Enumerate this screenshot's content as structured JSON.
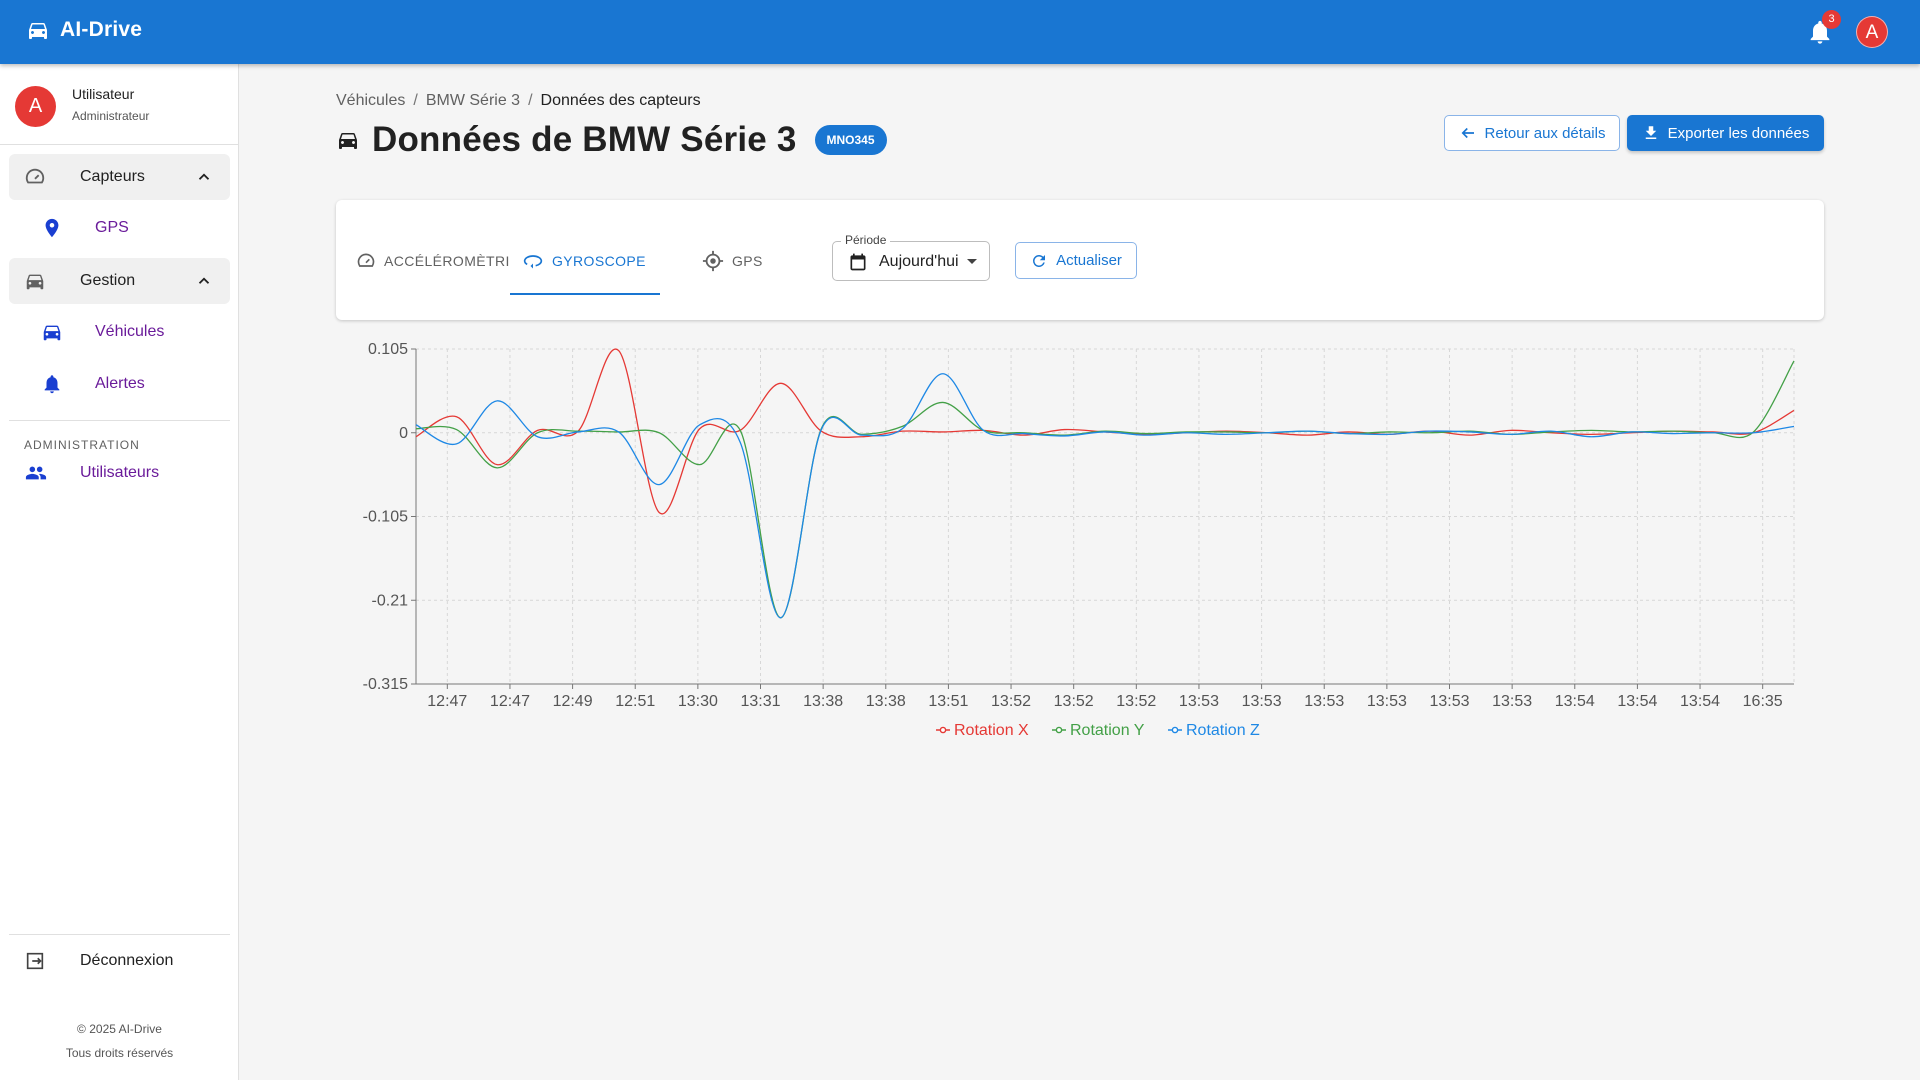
{
  "app": {
    "name": "AI-Drive",
    "notification_count": "3",
    "avatar_letter": "A"
  },
  "sidebar": {
    "user": {
      "avatar_letter": "A",
      "name": "Utilisateur",
      "role": "Administrateur"
    },
    "groups": [
      {
        "label": "Capteurs",
        "icon": "speedometer-icon",
        "items": [
          {
            "label": "GPS",
            "icon": "location-pin-icon"
          }
        ]
      },
      {
        "label": "Gestion",
        "icon": "car-icon",
        "items": [
          {
            "label": "Véhicules",
            "icon": "car-icon"
          },
          {
            "label": "Alertes",
            "icon": "bell-icon"
          }
        ]
      }
    ],
    "section_title": "ADMINISTRATION",
    "admin_item": {
      "label": "Utilisateurs",
      "icon": "people-icon"
    },
    "logout": "Déconnexion",
    "footer": [
      "© 2025 AI-Drive",
      "Tous droits réservés"
    ]
  },
  "breadcrumb": [
    "Véhicules",
    "BMW Série 3",
    "Données des capteurs"
  ],
  "page": {
    "title": "Données de BMW Série 3",
    "plate": "MNO345",
    "back_button": "Retour aux détails",
    "export_button": "Exporter les données"
  },
  "controls": {
    "tabs": [
      {
        "label": "ACCÉLÉROMÈTRI",
        "icon": "speedometer-icon",
        "active": false
      },
      {
        "label": "GYROSCOPE",
        "icon": "rotate-icon",
        "active": true
      },
      {
        "label": "GPS",
        "icon": "gps-target-icon",
        "active": false
      }
    ],
    "period_label": "Période",
    "period_value": "Aujourd'hui",
    "refresh_button": "Actualiser"
  },
  "colors": {
    "primary": "#1976d2",
    "series_x": "#e53935",
    "series_y": "#43a047",
    "series_z": "#1e88e5",
    "avatar": "#e53935"
  },
  "chart_data": {
    "type": "line",
    "x": [
      "12:47",
      "12:47",
      "12:49",
      "12:51",
      "13:30",
      "13:31",
      "13:38",
      "13:38",
      "13:51",
      "13:52",
      "13:52",
      "13:52",
      "13:53",
      "13:53",
      "13:53",
      "13:53",
      "13:53",
      "13:53",
      "13:54",
      "13:54",
      "13:54",
      "16:35"
    ],
    "yticks": [
      "0.105",
      "0",
      "-0.105",
      "-0.21",
      "-0.315"
    ],
    "ylim": [
      -0.315,
      0.105
    ],
    "grid": true,
    "legend_position": "bottom",
    "series": [
      {
        "name": "Rotation X",
        "color": "#e53935",
        "values": [
          -0.005,
          0.02,
          -0.04,
          0.003,
          0.002,
          0.103,
          -0.1,
          0.005,
          0.003,
          0.062,
          0.002,
          -0.005,
          0.002,
          0.001,
          0.003,
          -0.003,
          0.004,
          0.001,
          -0.002,
          0.0,
          0.002,
          0.0,
          -0.003,
          0.001,
          -0.002,
          0.002,
          -0.003,
          0.003,
          0.0,
          -0.002,
          0.0,
          0.002,
          0.001,
          0.0,
          0.028
        ]
      },
      {
        "name": "Rotation Y",
        "color": "#43a047",
        "values": [
          0.005,
          0.004,
          -0.044,
          0.0,
          0.002,
          0.001,
          0.0,
          -0.04,
          0.003,
          -0.232,
          0.005,
          -0.002,
          0.008,
          0.038,
          0.003,
          0.0,
          -0.003,
          0.002,
          -0.001,
          0.001,
          0.001,
          0.0,
          0.002,
          -0.001,
          0.001,
          0.0,
          0.002,
          -0.002,
          0.001,
          0.003,
          0.001,
          0.002,
          0.0,
          0.001,
          0.09
        ]
      },
      {
        "name": "Rotation Z",
        "color": "#1e88e5",
        "values": [
          0.01,
          -0.014,
          0.04,
          -0.005,
          0.001,
          0.001,
          -0.065,
          0.01,
          -0.012,
          -0.232,
          0.004,
          -0.003,
          0.005,
          0.074,
          0.003,
          -0.001,
          -0.004,
          0.001,
          -0.003,
          0.0,
          -0.002,
          0.0,
          0.002,
          -0.001,
          -0.002,
          0.002,
          0.001,
          -0.002,
          0.002,
          -0.005,
          0.001,
          -0.001,
          0.0,
          0.0,
          0.008
        ]
      }
    ]
  }
}
